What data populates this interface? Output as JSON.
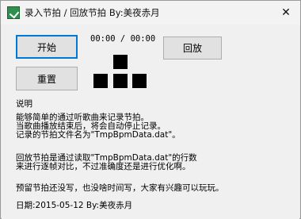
{
  "window": {
    "title": "录入节拍 / 回放节拍  By:美夜赤月",
    "close_glyph": "✕"
  },
  "controls": {
    "start_label": "开始",
    "reset_label": "重置",
    "playback_label": "回放",
    "timer": "00:00 / 00:00"
  },
  "description": {
    "heading": "说明",
    "para1": [
      "能够简单的通过听歌曲来记录节拍。",
      "当歌曲播放结束后，将会自动停止记录。",
      "记录的节拍文件名为\"TmpBpmData.dat\"。"
    ],
    "para2": [
      "回放节拍是通过读取\"TmpBpmData.dat\"的行数",
      "来进行逐帧对比，不过准确度还是进行优化啊。"
    ],
    "para3": "预留节拍还没写，也没啥时间写，大家有兴趣可以玩玩。",
    "footer": "日期:2015-05-12   By:美夜赤月"
  },
  "colors": {
    "focus_border": "#0078d7",
    "app_icon": "#2f8f4e"
  }
}
